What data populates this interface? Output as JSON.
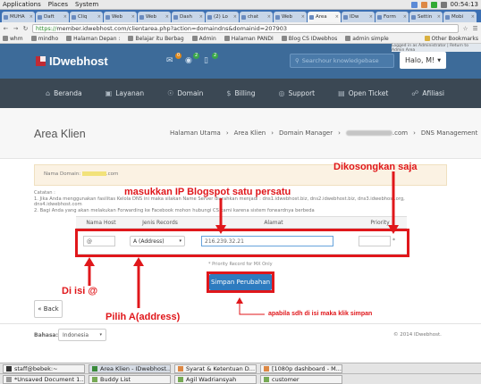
{
  "system_bar": {
    "menus": [
      "Applications",
      "Places",
      "System"
    ],
    "clock": "00:54:13"
  },
  "browser": {
    "tabs": [
      {
        "label": "MUHA"
      },
      {
        "label": "Daft"
      },
      {
        "label": "Cliq"
      },
      {
        "label": "Web"
      },
      {
        "label": "Web"
      },
      {
        "label": "Dash"
      },
      {
        "label": "(2) Lo"
      },
      {
        "label": "chat"
      },
      {
        "label": "Web"
      },
      {
        "label": "Area",
        "active": true
      },
      {
        "label": "IDw"
      },
      {
        "label": "Form"
      },
      {
        "label": "Settin"
      },
      {
        "label": "Mobi"
      }
    ],
    "url_scheme": "https://",
    "url_rest": "member.idwebhost.com/clientarea.php?action=domaindns&domainid=207903",
    "bookmarks": [
      {
        "label": "whm"
      },
      {
        "label": "mindho"
      },
      {
        "label": "Halaman Depan :"
      },
      {
        "label": "Belajar itu Berbag"
      },
      {
        "label": "Admin"
      },
      {
        "label": "Halaman PANDI"
      },
      {
        "label": "Blog CS IDwebhos"
      },
      {
        "label": "admin simple"
      }
    ],
    "other_bookmarks": "Other Bookmarks"
  },
  "site": {
    "logo_text": "IDwebhost",
    "badges": {
      "messages": "0",
      "notices": "2",
      "chat": "2"
    },
    "search_placeholder": "Searchour knowledgebase",
    "greeting": "Halo, M!",
    "admin_note": "Logged in as Administrator | Return to Admin Area",
    "nav": [
      {
        "label": "Beranda",
        "icon": "home-icon"
      },
      {
        "label": "Layanan",
        "icon": "briefcase-icon"
      },
      {
        "label": "Domain",
        "icon": "globe-icon"
      },
      {
        "label": "Billing",
        "icon": "dollar-icon"
      },
      {
        "label": "Support",
        "icon": "lifebuoy-icon"
      },
      {
        "label": "Open Ticket",
        "icon": "ticket-icon"
      },
      {
        "label": "Afiliasi",
        "icon": "affiliate-icon"
      }
    ]
  },
  "page": {
    "title": "Area Klien",
    "breadcrumb": [
      "Halaman Utama",
      "Area Klien",
      "Domain Manager",
      ".com",
      "DNS Management"
    ],
    "domain_label": "Nama Domain:",
    "domain_suffix": ".com",
    "notes_title": "Catatan :",
    "notes": [
      "1. Jika Anda menggunakan fasilitas Kelola DNS ini maka silakan Name Server diarahkan menjadi : dns1.idwebhost.biz, dns2.idwebhost.biz, dns3.idwebhost.org, dns4.idwebhost.com",
      "2. Bagi Anda yang akan melakukan Forwarding ke Facebook mohon hubungi CS kami karena sistem forwardnya berbeda"
    ],
    "table": {
      "headers": [
        "Nama Host",
        "Jenis Records",
        "Alamat",
        "Priority"
      ],
      "row": {
        "host": "@",
        "record_type": "A (Address)",
        "address": "216.239.32.21",
        "priority": "",
        "priority_mark": "*"
      }
    },
    "priority_note": "* Priority Record for MX Only",
    "save_button": "Simpan Perubahan",
    "back_button": "« Back",
    "language_label": "Bahasa:",
    "language_value": "Indonesia",
    "copyright": "© 2014 IDwebhost."
  },
  "annotations": {
    "a1": "masukkan IP Blogspot satu persatu",
    "a2": "Dikosongkan saja",
    "a3": "Di isi @",
    "a4": "Pilih A(address)",
    "a5": "apabila sdh di isi maka klik simpan"
  },
  "taskbar": {
    "row1": [
      "staff@bebek:~",
      "Area Klien - IDwebhost...",
      "Syarat & Ketentuan D...",
      "[1080p dashboard - M..."
    ],
    "row2": [
      "*Unsaved Document 1...",
      "Buddy List",
      "Agil Wadriansyah",
      "customer"
    ]
  },
  "colors": {
    "header_blue": "#3d6b99",
    "nav_dark": "#3b4854",
    "button_blue": "#2e7bbf",
    "annotation_red": "#e0171b"
  }
}
